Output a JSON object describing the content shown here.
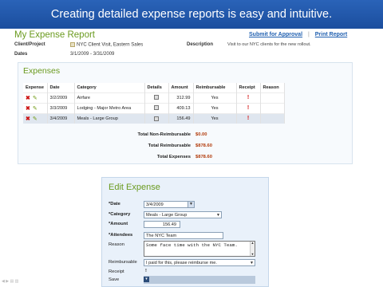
{
  "banner": {
    "text": "Creating detailed expense reports is easy and intuitive."
  },
  "report": {
    "title": "My Expense Report",
    "submit_link": "Submit for Approval",
    "separator": "|",
    "print_link": "Print Report",
    "client_label": "Client/Project",
    "client_value": "NYC Client Visit, Eastern Sales",
    "dates_label": "Dates",
    "dates_value": "3/1/2009 - 3/31/2009",
    "description_label": "Description",
    "description_value": "Visit to our NYC clients for the new rollout."
  },
  "expenses": {
    "title": "Expenses",
    "columns": [
      "Expense",
      "Date",
      "Category",
      "Details",
      "Amount",
      "Reimbursable",
      "Receipt",
      "Reason"
    ],
    "rows": [
      {
        "date": "3/2/2009",
        "category": "Airfare",
        "amount": "312.99",
        "reimbursable": "Yes",
        "receipt": "!",
        "reason": ""
      },
      {
        "date": "3/3/2009",
        "category": "Lodging - Major Metro Area",
        "amount": "409.13",
        "reimbursable": "Yes",
        "receipt": "!",
        "reason": ""
      },
      {
        "date": "3/4/2009",
        "category": "Meals - Large Group",
        "amount": "156.49",
        "reimbursable": "Yes",
        "receipt": "!",
        "reason": ""
      }
    ],
    "totals": [
      {
        "label": "Total Non-Reimbursable",
        "value": "$0.00"
      },
      {
        "label": "Total Reimbursable",
        "value": "$878.60"
      },
      {
        "label": "Total Expenses",
        "value": "$878.60"
      }
    ]
  },
  "edit": {
    "title": "Edit Expense",
    "date_label": "*Date",
    "date_value": "3/4/2009",
    "category_label": "*Category",
    "category_value": "Meals - Large Group",
    "amount_label": "*Amount",
    "amount_value": "156.49",
    "attendees_label": "*Attendees",
    "attendees_value": "The NYC Team",
    "reason_label": "Reason",
    "reason_value": "Some face time with the NYC Team.",
    "reimbursable_label": "Reimbursable",
    "reimbursable_value": "I paid for this, please reimburse me.",
    "receipt_label": "Receipt",
    "receipt_value": "!",
    "save_label": "Save"
  },
  "colors": {
    "accent": "#6a9a1e",
    "banner": "#1f57a8",
    "alert": "#d41111"
  }
}
